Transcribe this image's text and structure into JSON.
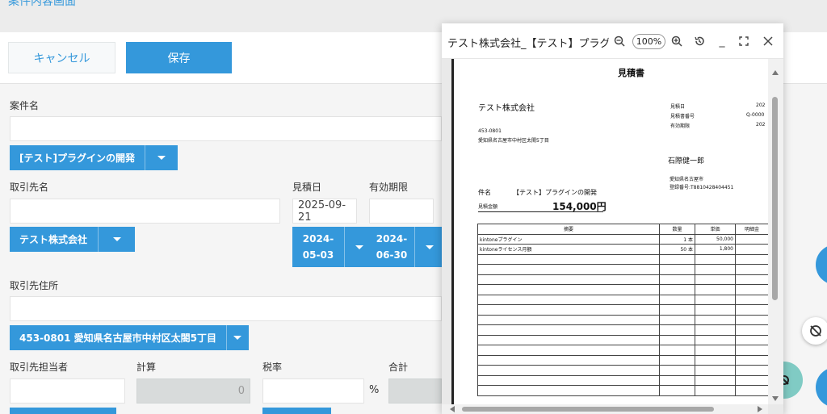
{
  "header": {
    "title_fragment": "案件内容画面"
  },
  "toolbar": {
    "cancel_label": "キャンセル",
    "save_label": "保存"
  },
  "form": {
    "project_name": {
      "label": "案件名",
      "value": "",
      "lookup": "[テスト]プラグインの開発"
    },
    "client_name": {
      "label": "取引先名",
      "value": "",
      "lookup": "テスト株式会社"
    },
    "estimate_date": {
      "label": "見積日",
      "value": "2025-09-21",
      "button_line1": "2024-",
      "button_line2": "05-03"
    },
    "valid_until": {
      "label": "有効期限",
      "value": "",
      "button_line1": "2024-",
      "button_line2": "06-30"
    },
    "client_address": {
      "label": "取引先住所",
      "value": "",
      "lookup": "453-0801 愛知県名古屋市中村区太閤5丁目"
    },
    "client_contact": {
      "label": "取引先担当者",
      "value": ""
    },
    "calc": {
      "label": "計算",
      "value": "0"
    },
    "tax_rate": {
      "label": "税率",
      "value": "",
      "unit": "%"
    },
    "total": {
      "label": "合計",
      "value": ""
    }
  },
  "pdf_viewer": {
    "title": "テスト株式会社_【テスト】プラグ...",
    "zoom": "100%",
    "icons": [
      "zoom-out-icon",
      "zoom-in-icon",
      "reset-icon",
      "minimize-icon",
      "fullscreen-icon",
      "close-icon"
    ],
    "minimize_glyph": "_",
    "document": {
      "heading": "見積書",
      "company": "テスト株式会社",
      "postal": "453-0801",
      "address": "愛知県名古屋市中村区太閤5丁目",
      "meta": [
        {
          "label": "見積日",
          "value": "202"
        },
        {
          "label": "見積書番号",
          "value": "Q-0000"
        },
        {
          "label": "有効期限",
          "value": "202"
        }
      ],
      "person": "石際健一郎",
      "issuer_address": "愛知県名古屋市",
      "registration": "登録番号:T8810428404451",
      "subject_label": "件名",
      "subject": "【テスト】プラグインの開発",
      "amount_label": "見積金額",
      "amount": "154,000円",
      "table_headers": [
        "摘要",
        "数量",
        "単価",
        "明細金"
      ],
      "rows": [
        [
          "kintoneプラグイン",
          "1 本",
          "50,000",
          ""
        ],
        [
          "kintoneライセンス月額",
          "50 本",
          "1,800",
          ""
        ],
        [
          "",
          "",
          "",
          ""
        ],
        [
          "",
          "",
          "",
          ""
        ],
        [
          "",
          "",
          "",
          ""
        ],
        [
          "",
          "",
          "",
          ""
        ],
        [
          "",
          "",
          "",
          ""
        ],
        [
          "",
          "",
          "",
          ""
        ],
        [
          "",
          "",
          "",
          ""
        ],
        [
          "",
          "",
          "",
          ""
        ],
        [
          "",
          "",
          "",
          ""
        ],
        [
          "",
          "",
          "",
          ""
        ],
        [
          "",
          "",
          "",
          ""
        ],
        [
          "",
          "",
          "",
          ""
        ],
        [
          "",
          "",
          "",
          ""
        ],
        [
          "",
          "",
          "",
          ""
        ]
      ]
    }
  },
  "colors": {
    "accent": "#3498db",
    "teal": "#80cbc4",
    "disabled": "#d8dbdb"
  }
}
